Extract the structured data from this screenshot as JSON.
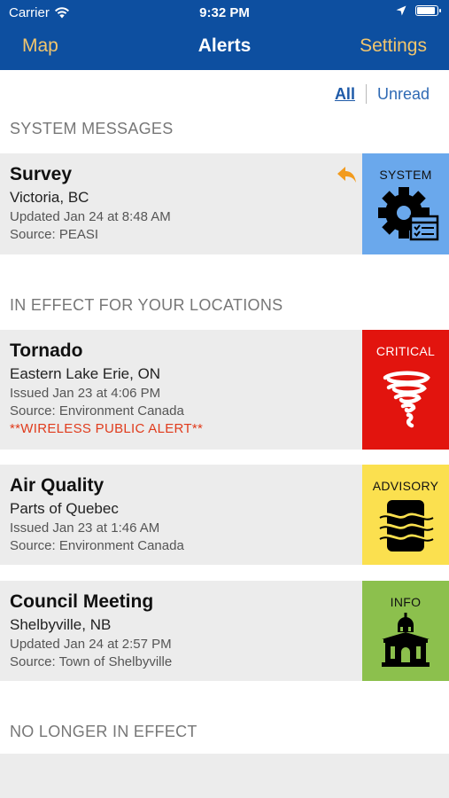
{
  "status_bar": {
    "carrier": "Carrier",
    "time": "9:32 PM"
  },
  "nav": {
    "left": "Map",
    "title": "Alerts",
    "right": "Settings"
  },
  "filter": {
    "all": "All",
    "unread": "Unread"
  },
  "sections": {
    "system": "SYSTEM MESSAGES",
    "in_effect": "IN EFFECT FOR YOUR LOCATIONS",
    "no_longer": "NO LONGER IN EFFECT"
  },
  "system_alert": {
    "title": "Survey",
    "location": "Victoria, BC",
    "updated": "Updated Jan 24 at 8:48 AM",
    "source": "Source: PEASI",
    "category": "SYSTEM",
    "tile_color": "#6aa8ec",
    "icon": "gear-checklist-icon"
  },
  "alerts": [
    {
      "title": "Tornado",
      "location": "Eastern Lake Erie, ON",
      "issued": "Issued Jan 23 at 4:06 PM",
      "source": "Source: Environment Canada",
      "note": "**WIRELESS PUBLIC ALERT**",
      "category": "CRITICAL",
      "tile_color": "#e2140e",
      "icon": "tornado-icon"
    },
    {
      "title": "Air Quality",
      "location": "Parts of Quebec",
      "issued": "Issued Jan 23 at 1:46 AM",
      "source": "Source: Environment Canada",
      "category": "ADVISORY",
      "tile_color": "#fbe04f",
      "icon": "air-quality-icon"
    },
    {
      "title": "Council Meeting",
      "location": "Shelbyville, NB",
      "issued": "Updated Jan 24 at 2:57 PM",
      "source": "Source: Town of Shelbyville",
      "category": "INFO",
      "tile_color": "#8cc04d",
      "icon": "city-hall-icon"
    }
  ],
  "colors": {
    "nav_bar": "#0d4fa0",
    "nav_link": "#f2c66d",
    "reply_arrow": "#f29b1e",
    "card_bg": "#ececec"
  }
}
